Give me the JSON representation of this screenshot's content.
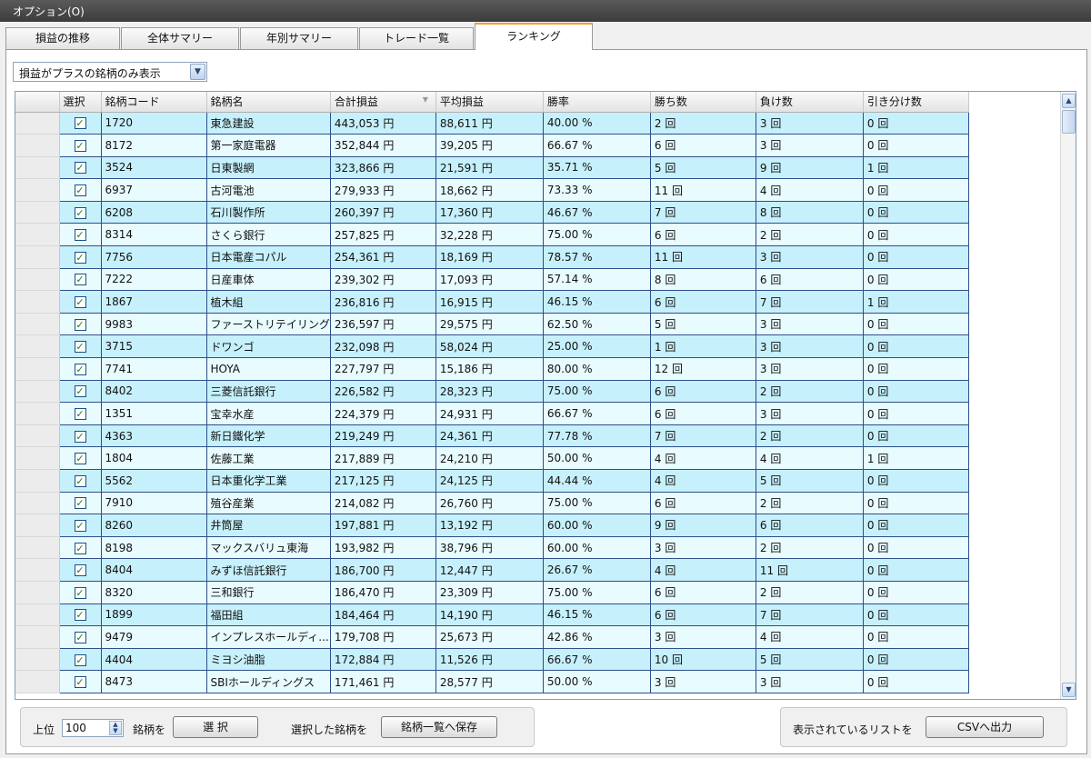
{
  "menu": {
    "options_label": "オプション(O)"
  },
  "tabs": [
    {
      "label": "損益の推移"
    },
    {
      "label": "全体サマリー"
    },
    {
      "label": "年別サマリー"
    },
    {
      "label": "トレード一覧"
    },
    {
      "label": "ランキング"
    }
  ],
  "active_tab": "ランキング",
  "filter": {
    "selected": "損益がプラスの銘柄のみ表示"
  },
  "table": {
    "columns": [
      "選択",
      "銘柄コード",
      "銘柄名",
      "合計損益",
      "平均損益",
      "勝率",
      "勝ち数",
      "負け数",
      "引き分け数"
    ],
    "sorted_column": "合計損益",
    "rows": [
      [
        "1720",
        "東急建設",
        "443,053 円",
        "88,611 円",
        "40.00 %",
        "2 回",
        "3 回",
        "0 回"
      ],
      [
        "8172",
        "第一家庭電器",
        "352,844 円",
        "39,205 円",
        "66.67 %",
        "6 回",
        "3 回",
        "0 回"
      ],
      [
        "3524",
        "日東製網",
        "323,866 円",
        "21,591 円",
        "35.71 %",
        "5 回",
        "9 回",
        "1 回"
      ],
      [
        "6937",
        "古河電池",
        "279,933 円",
        "18,662 円",
        "73.33 %",
        "11 回",
        "4 回",
        "0 回"
      ],
      [
        "6208",
        "石川製作所",
        "260,397 円",
        "17,360 円",
        "46.67 %",
        "7 回",
        "8 回",
        "0 回"
      ],
      [
        "8314",
        "さくら銀行",
        "257,825 円",
        "32,228 円",
        "75.00 %",
        "6 回",
        "2 回",
        "0 回"
      ],
      [
        "7756",
        "日本電産コパル",
        "254,361 円",
        "18,169 円",
        "78.57 %",
        "11 回",
        "3 回",
        "0 回"
      ],
      [
        "7222",
        "日産車体",
        "239,302 円",
        "17,093 円",
        "57.14 %",
        "8 回",
        "6 回",
        "0 回"
      ],
      [
        "1867",
        "植木組",
        "236,816 円",
        "16,915 円",
        "46.15 %",
        "6 回",
        "7 回",
        "1 回"
      ],
      [
        "9983",
        "ファーストリテイリング",
        "236,597 円",
        "29,575 円",
        "62.50 %",
        "5 回",
        "3 回",
        "0 回"
      ],
      [
        "3715",
        "ドワンゴ",
        "232,098 円",
        "58,024 円",
        "25.00 %",
        "1 回",
        "3 回",
        "0 回"
      ],
      [
        "7741",
        "HOYA",
        "227,797 円",
        "15,186 円",
        "80.00 %",
        "12 回",
        "3 回",
        "0 回"
      ],
      [
        "8402",
        "三菱信託銀行",
        "226,582 円",
        "28,323 円",
        "75.00 %",
        "6 回",
        "2 回",
        "0 回"
      ],
      [
        "1351",
        "宝幸水産",
        "224,379 円",
        "24,931 円",
        "66.67 %",
        "6 回",
        "3 回",
        "0 回"
      ],
      [
        "4363",
        "新日鐵化学",
        "219,249 円",
        "24,361 円",
        "77.78 %",
        "7 回",
        "2 回",
        "0 回"
      ],
      [
        "1804",
        "佐藤工業",
        "217,889 円",
        "24,210 円",
        "50.00 %",
        "4 回",
        "4 回",
        "1 回"
      ],
      [
        "5562",
        "日本重化学工業",
        "217,125 円",
        "24,125 円",
        "44.44 %",
        "4 回",
        "5 回",
        "0 回"
      ],
      [
        "7910",
        "殖谷産業",
        "214,082 円",
        "26,760 円",
        "75.00 %",
        "6 回",
        "2 回",
        "0 回"
      ],
      [
        "8260",
        "井筒屋",
        "197,881 円",
        "13,192 円",
        "60.00 %",
        "9 回",
        "6 回",
        "0 回"
      ],
      [
        "8198",
        "マックスバリュ東海",
        "193,982 円",
        "38,796 円",
        "60.00 %",
        "3 回",
        "2 回",
        "0 回"
      ],
      [
        "8404",
        "みずほ信託銀行",
        "186,700 円",
        "12,447 円",
        "26.67 %",
        "4 回",
        "11 回",
        "0 回"
      ],
      [
        "8320",
        "三和銀行",
        "186,470 円",
        "23,309 円",
        "75.00 %",
        "6 回",
        "2 回",
        "0 回"
      ],
      [
        "1899",
        "福田組",
        "184,464 円",
        "14,190 円",
        "46.15 %",
        "6 回",
        "7 回",
        "0 回"
      ],
      [
        "9479",
        "インプレスホールディ...",
        "179,708 円",
        "25,673 円",
        "42.86 %",
        "3 回",
        "4 回",
        "0 回"
      ],
      [
        "4404",
        "ミヨシ油脂",
        "172,884 円",
        "11,526 円",
        "66.67 %",
        "10 回",
        "5 回",
        "0 回"
      ],
      [
        "8473",
        "SBIホールディングス",
        "171,461 円",
        "28,577 円",
        "50.00 %",
        "3 回",
        "3 回",
        "0 回"
      ]
    ]
  },
  "bottom": {
    "top_label": "上位",
    "top_value": "100",
    "stocks_label": "銘柄を",
    "select_button": "選 択",
    "selected_label": "選択した銘柄を",
    "save_button": "銘柄一覧へ保存",
    "list_label": "表示されているリストを",
    "csv_button": "CSVへ出力"
  }
}
